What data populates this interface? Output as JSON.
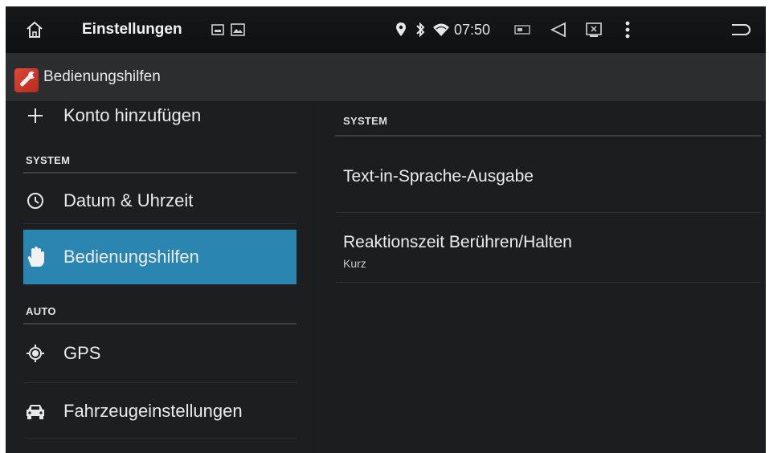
{
  "statusbar": {
    "title": "Einstellungen",
    "time": "07:50",
    "icons": [
      "home-icon",
      "image-icon",
      "gallery-icon",
      "location-icon",
      "bluetooth-icon",
      "wifi-icon",
      "screen-icon",
      "volume-icon",
      "screenshot-icon",
      "overflow-menu-icon",
      "back-icon"
    ]
  },
  "actionbar": {
    "title": "Bedienungshilfen",
    "icon": "accessibility-app-icon"
  },
  "left": {
    "items": [
      {
        "type": "item",
        "label": "Konto hinzufügen",
        "icon": "plus-icon"
      },
      {
        "type": "header",
        "label": "SYSTEM"
      },
      {
        "type": "item",
        "label": "Datum & Uhrzeit",
        "icon": "clock-icon"
      },
      {
        "type": "item",
        "label": "Bedienungshilfen",
        "icon": "hand-icon",
        "selected": true
      },
      {
        "type": "header",
        "label": "AUTO"
      },
      {
        "type": "item",
        "label": "GPS",
        "icon": "gps-icon"
      },
      {
        "type": "item",
        "label": "Fahrzeugeinstellungen",
        "icon": "car-icon"
      }
    ]
  },
  "right": {
    "header": "SYSTEM",
    "items": [
      {
        "title": "Text-in-Sprache-Ausgabe",
        "summary": ""
      },
      {
        "title": "Reaktionszeit Berühren/Halten",
        "summary": "Kurz"
      }
    ]
  },
  "colors": {
    "accent": "#2a86b0",
    "background": "#1a1c1e",
    "actionbar": "#2b2d2f"
  }
}
